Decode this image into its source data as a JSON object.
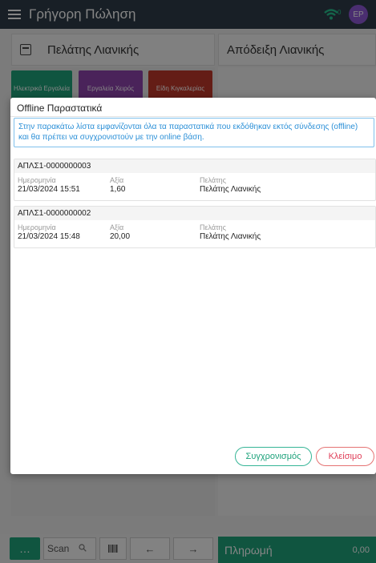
{
  "topbar": {
    "title": "Γρήγορη Πώληση",
    "avatar_initials": "EP"
  },
  "header": {
    "customer": "Πελάτης Λιανικής",
    "receipt_title": "Απόδειξη Λιανικής"
  },
  "categories": [
    {
      "label": "Ηλεκτρικά Εργαλεία",
      "color": "#1fa37c"
    },
    {
      "label": "Εργαλεία Χειρός",
      "color": "#8e44ad"
    },
    {
      "label": "Είδη Κιγκαλερίας",
      "color": "#c0392b"
    }
  ],
  "bottombar": {
    "more": "…",
    "scan_label": "Scan",
    "pay_label": "Πληρωμή",
    "pay_amount": "0,00"
  },
  "modal": {
    "title": "Offline Παραστατικά",
    "info": "Στην παρακάτω λίστα εμφανίζονται όλα τα παραστατικά που εκδόθηκαν εκτός σύνδεσης (offline) και θα πρέπει να συγχρονιστούν με την online βάση.",
    "labels": {
      "date": "Ημερομηνία",
      "value": "Αξία",
      "customer": "Πελάτης"
    },
    "documents": [
      {
        "number": "ΑΠΛΣ1-0000000003",
        "date": "21/03/2024 15:51",
        "value": "1,60",
        "customer": "Πελάτης Λιανικής"
      },
      {
        "number": "ΑΠΛΣ1-0000000002",
        "date": "21/03/2024 15:48",
        "value": "20,00",
        "customer": "Πελάτης Λιανικής"
      }
    ],
    "sync_button": "Συγχρονισμός",
    "close_button": "Κλείσιμο"
  },
  "colors": {
    "accent": "#1fa37c",
    "danger": "#e0405a",
    "info": "#2a8fd7",
    "topbar": "#2f3c49"
  }
}
